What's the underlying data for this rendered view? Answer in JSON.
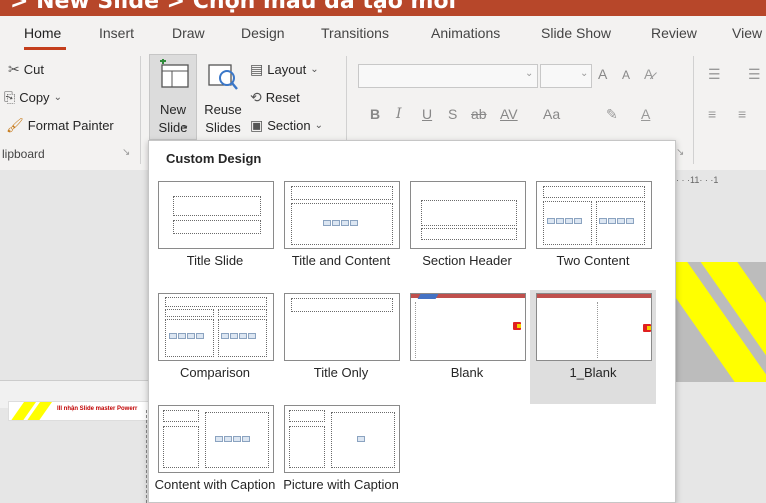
{
  "banner": {
    "text": "> New Slide > Chọn mẫu đã tạo mới"
  },
  "tabs": [
    "Home",
    "Insert",
    "Draw",
    "Design",
    "Transitions",
    "Animations",
    "Slide Show",
    "Review",
    "View"
  ],
  "clipboard": {
    "cut": "Cut",
    "copy": "Copy",
    "format_painter": "Format Painter",
    "group_label": "lipboard"
  },
  "slides": {
    "new_slide_1": "New",
    "new_slide_2": "Slide",
    "reuse_1": "Reuse",
    "reuse_2": "Slides",
    "layout": "Layout",
    "reset": "Reset",
    "section": "Section"
  },
  "font": {
    "bold": "B",
    "italic": "I",
    "underline": "U",
    "strike": "S",
    "abc": "ab",
    "spacing": "AV",
    "case": "Aa",
    "grow": "A",
    "shrink": "A"
  },
  "ruler": {
    "marks": "· · ·11· · ·1"
  },
  "thumbnail": {
    "text": "III nhận Slide master Powerr"
  },
  "gallery": {
    "title": "Custom Design",
    "selected": "1_Blank",
    "layouts": [
      "Title Slide",
      "Title and Content",
      "Section Header",
      "Two Content",
      "Comparison",
      "Title Only",
      "Blank",
      "1_Blank",
      "Content with Caption",
      "Picture with Caption"
    ]
  },
  "colors": {
    "accent": "#c43e1c",
    "ribbon_bg": "#f3f2f1",
    "highlight": "#ffff00"
  }
}
